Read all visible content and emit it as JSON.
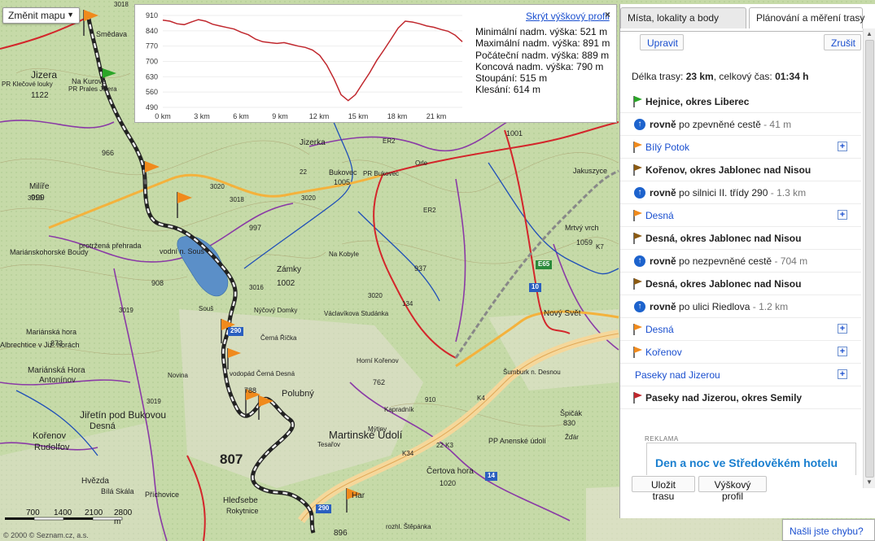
{
  "map_type": {
    "label": "Změnit mapu"
  },
  "profile": {
    "hide_link": "Skrýt výškový profil",
    "close": "×",
    "y_ticks": [
      "910",
      "840",
      "770",
      "700",
      "630",
      "560",
      "490"
    ],
    "x_ticks": [
      "0 km",
      "3 km",
      "6 km",
      "9 km",
      "12 km",
      "15 km",
      "18 km",
      "21 km"
    ],
    "line_color": "#c0272d",
    "elevation_m": [
      889,
      884,
      872,
      868,
      880,
      891,
      884,
      870,
      862,
      855,
      848,
      833,
      822,
      802,
      790,
      786,
      782,
      786,
      778,
      770,
      764,
      752,
      728,
      683,
      621,
      548,
      521,
      548,
      598,
      648,
      705,
      752,
      802,
      852,
      884,
      880,
      872,
      862,
      856,
      846,
      838,
      820,
      790
    ],
    "stats": [
      "Minimální nadm. výška: 521 m",
      "Maximální nadm. výška: 891 m",
      "Počáteční nadm. výška: 889 m",
      "Koncová nadm. výška: 790 m",
      "Stoupání: 515 m",
      "Klesání: 614 m"
    ]
  },
  "panel": {
    "tabs": [
      "Místa, lokality a body",
      "Plánování a měření trasy"
    ],
    "edit_label": "Upravit",
    "cancel_label": "Zrušit",
    "summary_prefix": "Délka trasy: ",
    "length": "23 km",
    "summary_mid": ", celkový čas: ",
    "time": "01:34 h",
    "route": [
      {
        "kind": "place",
        "flag": "green",
        "text": "Hejnice, okres Liberec"
      },
      {
        "kind": "step",
        "dir": "rovně",
        "text": " po zpevněné cestě",
        "dist": " - 41 m"
      },
      {
        "kind": "waypoint",
        "flag": "orange",
        "text": "Bílý Potok"
      },
      {
        "kind": "place",
        "flag": "brown",
        "text": "Kořenov, okres Jablonec nad Nisou"
      },
      {
        "kind": "step",
        "dir": "rovně",
        "text": " po silnici II. třídy 290",
        "dist": " - 1.3 km"
      },
      {
        "kind": "waypoint",
        "flag": "orange",
        "text": "Desná"
      },
      {
        "kind": "place",
        "flag": "brown",
        "text": "Desná, okres Jablonec nad Nisou"
      },
      {
        "kind": "step",
        "dir": "rovně",
        "text": " po nezpevněné cestě",
        "dist": " - 704 m"
      },
      {
        "kind": "place",
        "flag": "brown",
        "text": "Desná, okres Jablonec nad Nisou"
      },
      {
        "kind": "step",
        "dir": "rovně",
        "text": " po ulici Riedlova",
        "dist": " - 1.2 km"
      },
      {
        "kind": "waypoint",
        "flag": "orange",
        "text": "Desná"
      },
      {
        "kind": "waypoint",
        "flag": "orange",
        "text": "Kořenov"
      },
      {
        "kind": "waypoint",
        "flag": "none",
        "text": "Paseky nad Jizerou"
      },
      {
        "kind": "place",
        "flag": "red",
        "text": "Paseky nad Jizerou, okres Semily"
      }
    ],
    "ad_label": "REKLAMA",
    "ad_title": "Den a noc ve Středověkém hotelu",
    "save_label": "Uložit trasu",
    "profile_label": "Výškový profil"
  },
  "bug_link": "Našli jste chybu?",
  "scale": {
    "labels": [
      "700",
      "1400",
      "2100",
      "2800 m"
    ]
  },
  "copyright": "© 2000 © Seznam.cz, a.s.",
  "map_labels": [
    "Smědava",
    "Jizera",
    "1122",
    "Na Kurově",
    "PR Prales Jizera",
    "PR Klečové louky",
    "966",
    "Milíře",
    "999",
    "Mariánskohorské Boudy",
    "908",
    "protržená přehrada",
    "vodní n. Souš",
    "997",
    "Zámky",
    "1002",
    "Jizerka",
    "Bukovec",
    "1005",
    "PR Bukovec",
    "Orle",
    "1001",
    "Jakuszyce",
    "937",
    "Na Kobyle",
    "Mrtvý vrch",
    "1059",
    "Nový Svět",
    "Souš",
    "Nýčový Domky",
    "Černá Říčka",
    "Václavíkova Studánka",
    "Horní Kořenov",
    "vodopád Černá Desná",
    "788",
    "Polubný",
    "Novina",
    "Mariánská hora",
    "873",
    "Mariánská Hora",
    "Antonínov",
    "Albrechtice v Jiz. horách",
    "Jiřetín pod Bukovou",
    "Desná",
    "Kořenov",
    "Rudolfov",
    "807",
    "Martinské Údolí",
    "Mýtiny",
    "762",
    "Kapradník",
    "910",
    "Tesařov",
    "Čertova hora",
    "1020",
    "PP Anenské údolí",
    "Špičák",
    "830",
    "Žďár",
    "Šumburk n. Desnou",
    "Hvězda",
    "Bílá Skála",
    "Příchovice",
    "Hleďsebe",
    "Rokytnice",
    "Har",
    "rozhl. Štěpánka",
    "896"
  ],
  "road_numbers": [
    "3018",
    "3020",
    "3020",
    "3018",
    "3019",
    "3016",
    "3020",
    "134",
    "ER2",
    "ER2",
    "E65",
    "10",
    "14",
    "290",
    "290",
    "22",
    "22 K3",
    "K4",
    "K34",
    "K7",
    "3019",
    "3019"
  ],
  "map_colors": {
    "forest": "#c6daa8",
    "road_red": "#d3262b",
    "road_orange": "#f4b23c",
    "lake": "#5b8fc8",
    "trail_purple": "#8a3aa6",
    "route": "#333333"
  }
}
